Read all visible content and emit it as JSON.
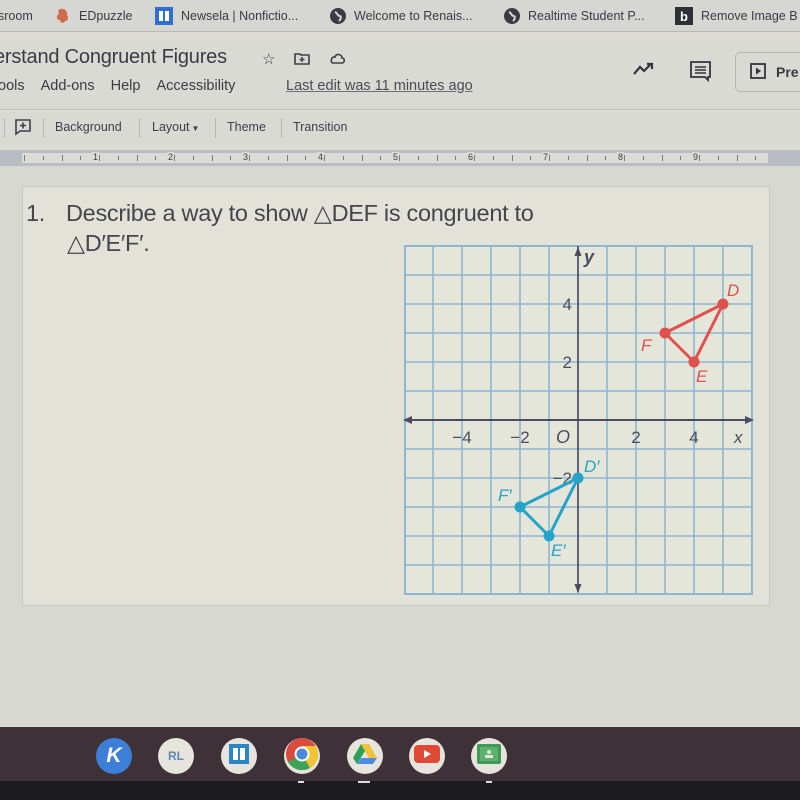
{
  "bookmarks": [
    {
      "label": "sroom",
      "icon": "classroom-icon"
    },
    {
      "label": "EDpuzzle",
      "icon": "edpuzzle-icon"
    },
    {
      "label": "Newsela | Nonfictio...",
      "icon": "newsela-icon"
    },
    {
      "label": "Welcome to Renais...",
      "icon": "globe-icon"
    },
    {
      "label": "Realtime Student P...",
      "icon": "globe-icon"
    },
    {
      "label": "Remove Image B",
      "icon": "remove-bg-icon"
    }
  ],
  "document": {
    "title": "erstand Congruent Figures",
    "menu": [
      "ools",
      "Add-ons",
      "Help",
      "Accessibility"
    ],
    "last_edit": "Last edit was 11 minutes ago",
    "present_label": "Pre"
  },
  "toolbar": {
    "background": "Background",
    "layout": "Layout",
    "theme": "Theme",
    "transition": "Transition"
  },
  "ruler": {
    "labels": [
      "1",
      "2",
      "3",
      "4",
      "5",
      "6",
      "7",
      "8",
      "9"
    ]
  },
  "slide": {
    "question_number": "1.",
    "question_line1": "Describe a way to show △DEF is congruent to",
    "question_line2": "△D′E′F′."
  },
  "chart_data": {
    "type": "scatter",
    "title": "",
    "xlabel": "x",
    "ylabel": "y",
    "xlim": [
      -6,
      6
    ],
    "ylim": [
      -6,
      6
    ],
    "grid": true,
    "origin_label": "O",
    "x_ticks": [
      {
        "value": -4,
        "label": "−4"
      },
      {
        "value": -2,
        "label": "−2"
      },
      {
        "value": 2,
        "label": "2"
      },
      {
        "value": 4,
        "label": "4"
      }
    ],
    "y_ticks": [
      {
        "value": 4,
        "label": "4"
      },
      {
        "value": 2,
        "label": "2"
      },
      {
        "value": -2,
        "label": "−2"
      }
    ],
    "series": [
      {
        "name": "DEF",
        "color": "#e0504c",
        "closed": true,
        "points": [
          {
            "label": "D",
            "x": 5,
            "y": 4
          },
          {
            "label": "E",
            "x": 4,
            "y": 2
          },
          {
            "label": "F",
            "x": 3,
            "y": 3
          }
        ]
      },
      {
        "name": "D'E'F'",
        "color": "#25a3c9",
        "closed": true,
        "points": [
          {
            "label": "D′",
            "x": 0,
            "y": -2
          },
          {
            "label": "E′",
            "x": -1,
            "y": -4
          },
          {
            "label": "F′",
            "x": -2,
            "y": -3
          }
        ]
      }
    ]
  },
  "shelf": {
    "apps": [
      {
        "name": "kami-app",
        "label": "K",
        "bg": "#3d7fd6",
        "fg": "#ffffff"
      },
      {
        "name": "readlive-app",
        "label": "RL",
        "bg": "#e6e4dc",
        "fg": "#5f87b8"
      },
      {
        "name": "newsela-app",
        "label": "",
        "bg": "#e6e4dc",
        "fg": "#2a87c7"
      },
      {
        "name": "chrome-app",
        "label": "",
        "bg": "#e6e4dc",
        "fg": ""
      },
      {
        "name": "drive-app",
        "label": "",
        "bg": "#e6e4dc",
        "fg": ""
      },
      {
        "name": "youtube-app",
        "label": "",
        "bg": "#e6e4dc",
        "fg": "#e04a35"
      },
      {
        "name": "classroom-app",
        "label": "",
        "bg": "#e6e4dc",
        "fg": "#3f9a56"
      }
    ]
  }
}
